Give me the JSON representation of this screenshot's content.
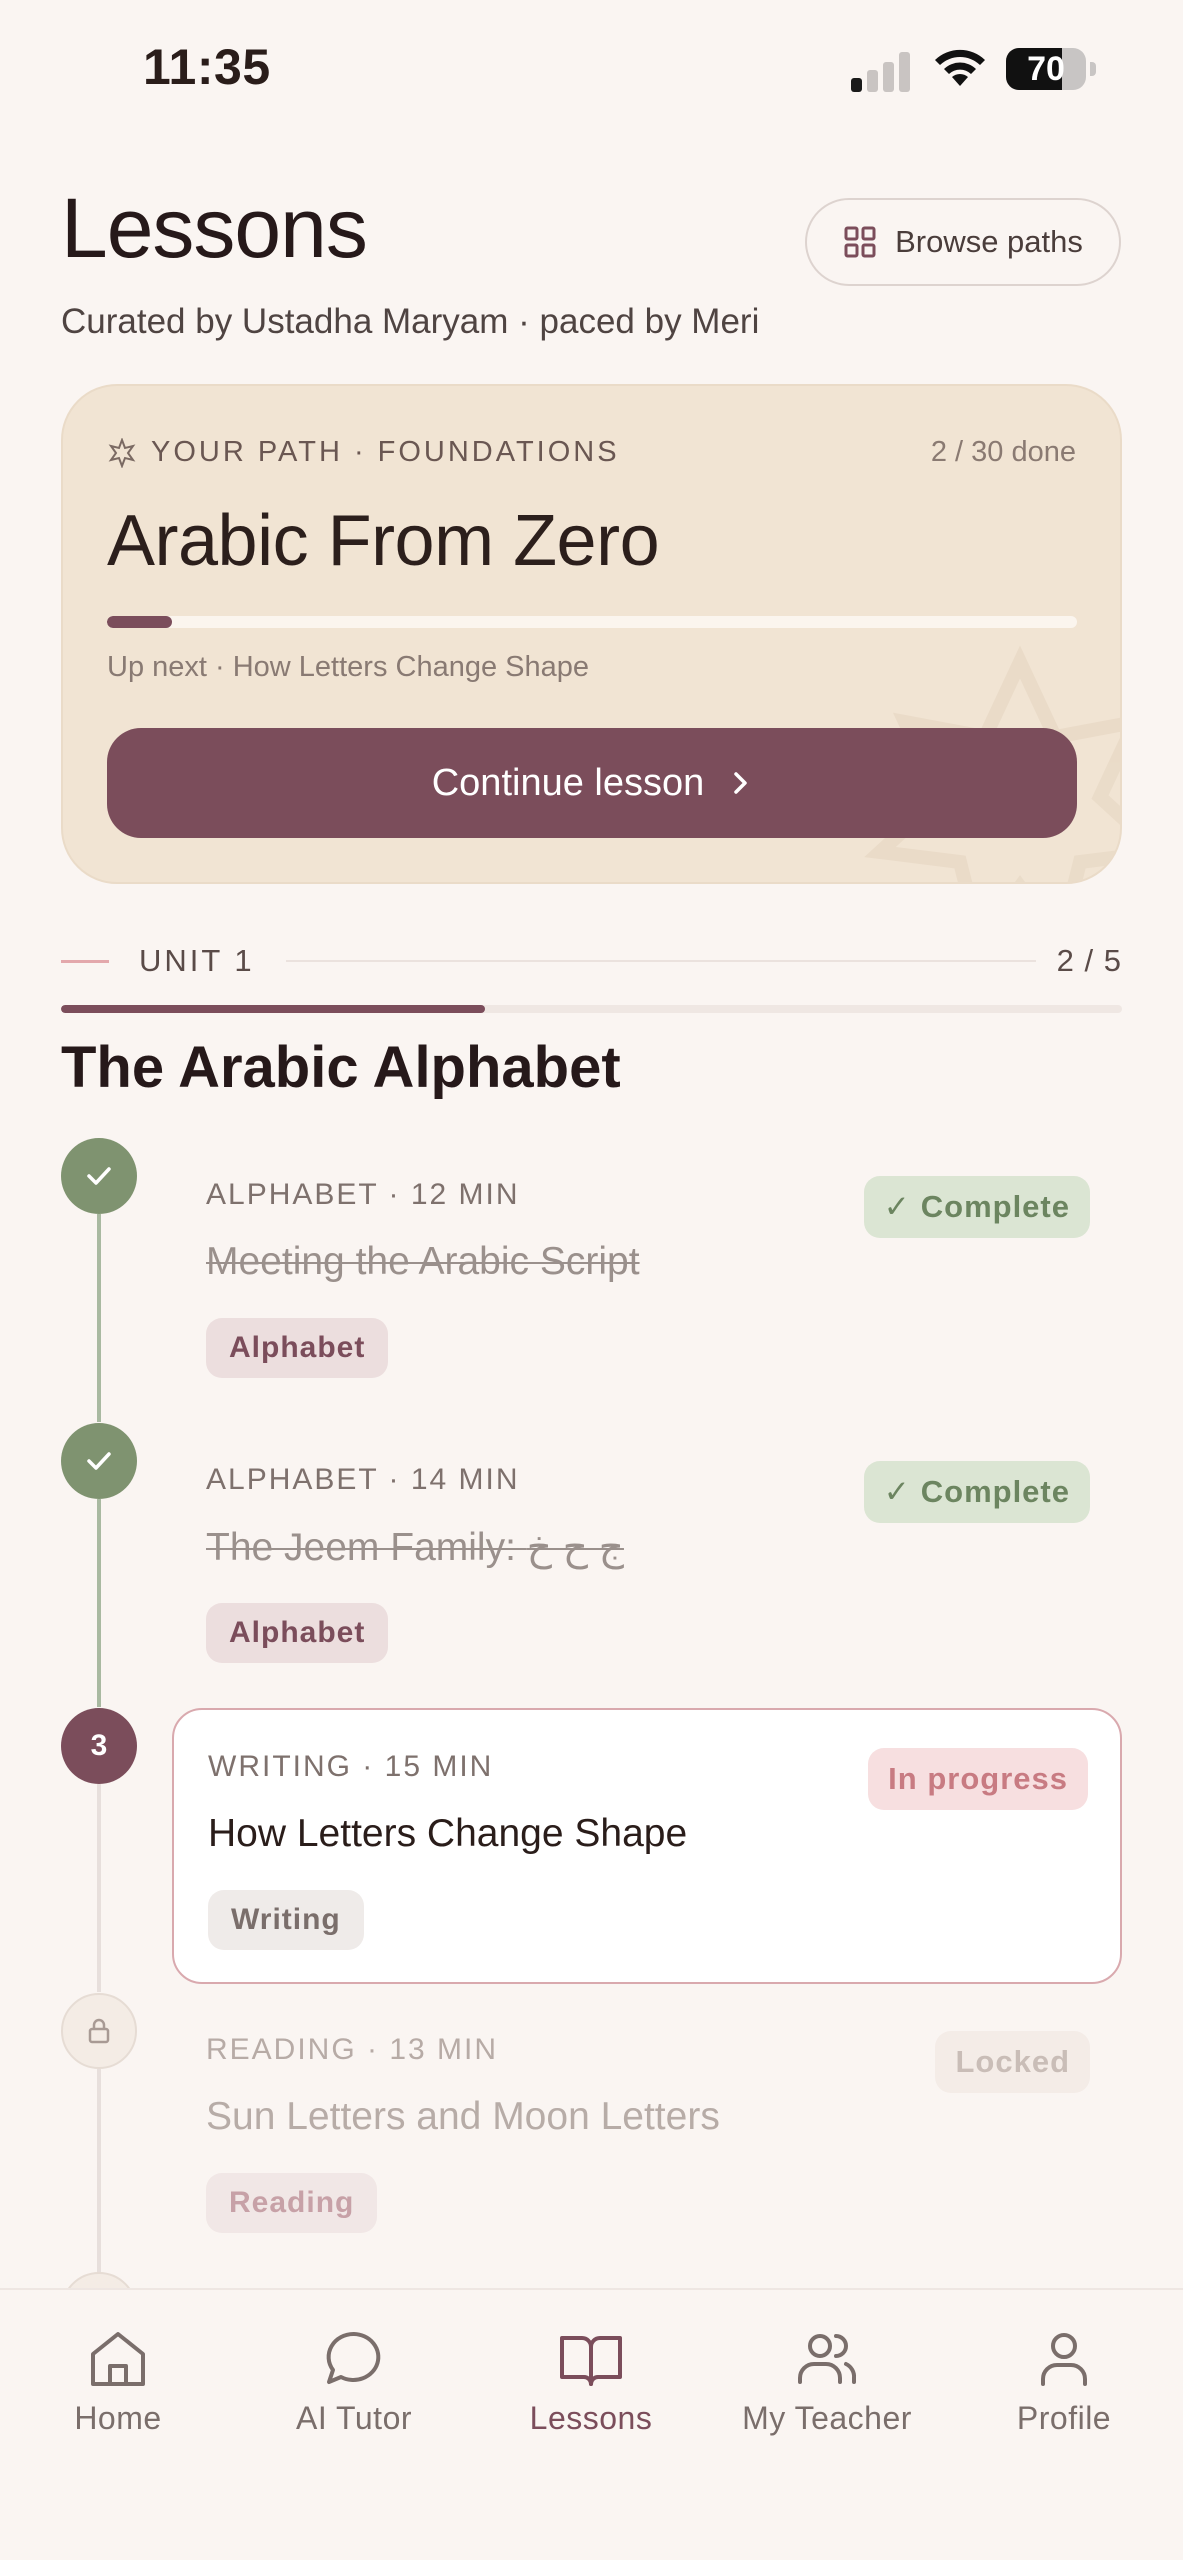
{
  "status_bar": {
    "time": "11:35",
    "battery": "70",
    "battery_level": 0.7
  },
  "header": {
    "title": "Lessons",
    "subtitle": "Curated by Ustadha Maryam · paced by Meri",
    "browse_label": "Browse paths"
  },
  "path_card": {
    "label": "YOUR PATH · FOUNDATIONS",
    "count": "2 / 30 done",
    "title": "Arabic From Zero",
    "progress": 0.067,
    "next": "Up next · How Letters Change Shape",
    "continue_label": "Continue lesson"
  },
  "unit": {
    "label": "UNIT 1",
    "count": "2 / 5",
    "progress": 0.4,
    "title": "The Arabic Alphabet"
  },
  "lessons": [
    {
      "meta": "ALPHABET · 12 MIN",
      "title": "Meeting the Arabic Script",
      "tag": "Alphabet",
      "status": "Complete",
      "status_icon": "check-icon"
    },
    {
      "meta": "ALPHABET · 14 MIN",
      "title": "The Jeem Family: ج ح خ",
      "tag": "Alphabet",
      "status": "Complete",
      "status_icon": "check-icon"
    },
    {
      "meta": "WRITING · 15 MIN",
      "title": "How Letters Change Shape",
      "tag": "Writing",
      "status": "In progress",
      "number": "3"
    },
    {
      "meta": "READING · 13 MIN",
      "title": "Sun Letters and Moon Letters",
      "tag": "Reading",
      "status": "Locked",
      "node_icon": "lock-icon"
    }
  ],
  "nav": [
    {
      "label": "Home",
      "icon": "home-icon"
    },
    {
      "label": "AI Tutor",
      "icon": "chat-icon"
    },
    {
      "label": "Lessons",
      "icon": "book-icon",
      "active": true
    },
    {
      "label": "My Teacher",
      "icon": "users-icon"
    },
    {
      "label": "Profile",
      "icon": "user-icon"
    }
  ],
  "colors": {
    "accent": "#7b4d5b",
    "complete": "#7f9370",
    "background": "#faf5f2",
    "card": "#f1e4d3"
  }
}
